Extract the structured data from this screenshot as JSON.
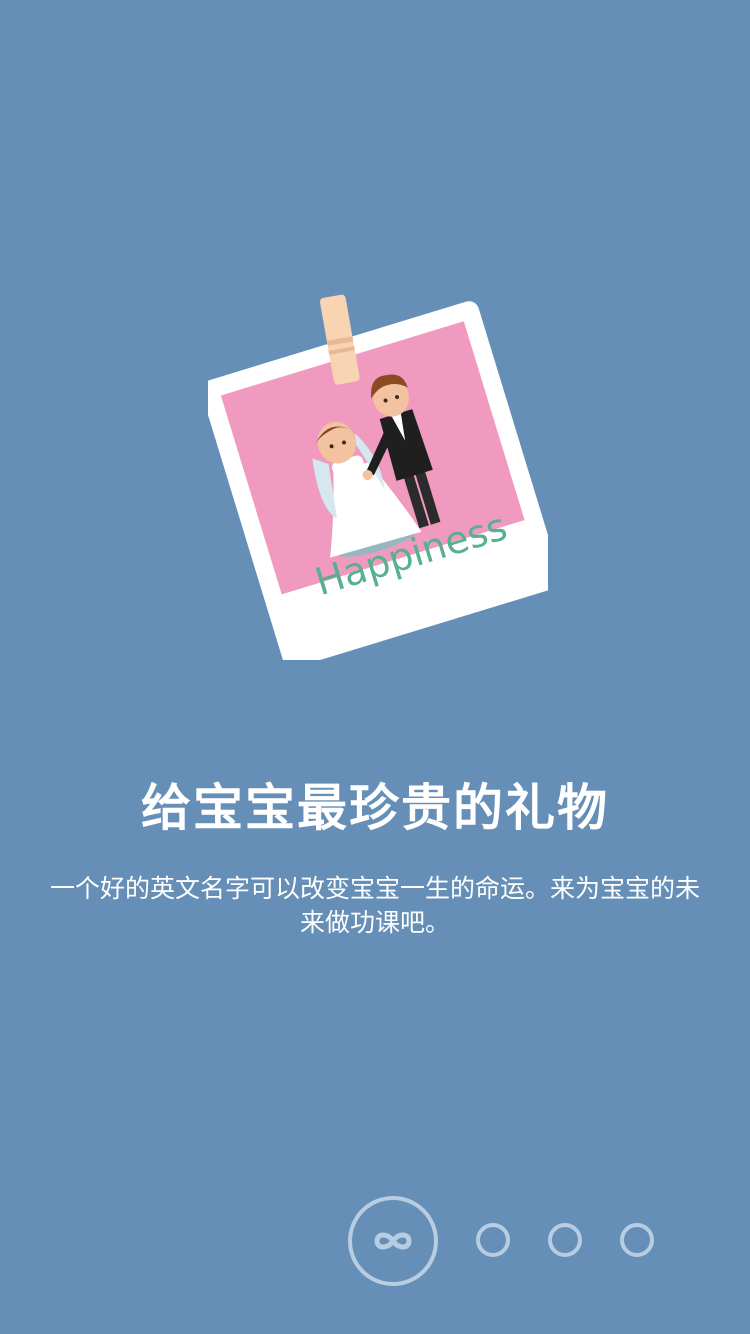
{
  "illustration": {
    "caption": "Happiness",
    "icon": "wedding-couple-photo",
    "colors": {
      "frame": "#ffffff",
      "photo_bg": "#f19ac0",
      "caption": "#58b08e",
      "clip": "#f8d4b3"
    }
  },
  "onboarding": {
    "title": "给宝宝最珍贵的礼物",
    "description": "一个好的英文名字可以改变宝宝一生的命运。来为宝宝的未来做功课吧。"
  },
  "pager": {
    "total": 4,
    "active_index": 0,
    "active_icon": "infinity-icon"
  },
  "theme": {
    "background": "#668fb7",
    "pager_color": "#b8cde2"
  }
}
